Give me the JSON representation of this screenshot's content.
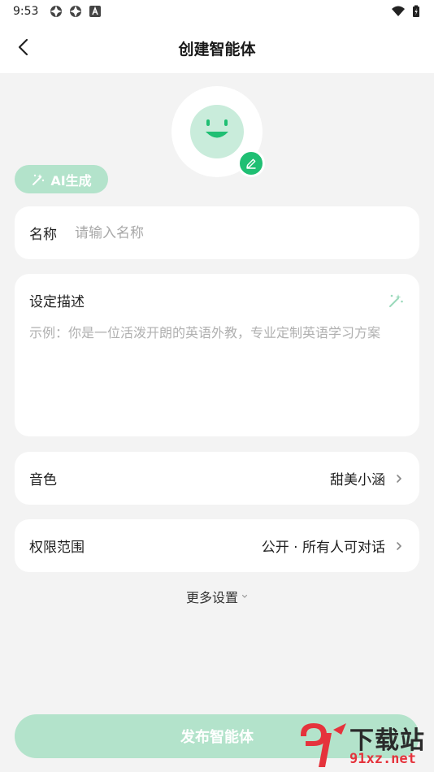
{
  "status_bar": {
    "time": "9:53"
  },
  "header": {
    "title": "创建智能体"
  },
  "avatar": {
    "ai_generate_label": "AI生成"
  },
  "name_field": {
    "label": "名称",
    "placeholder": "请输入名称",
    "value": ""
  },
  "description": {
    "label": "设定描述",
    "placeholder": "示例：你是一位活泼开朗的英语外教，专业定制英语学习方案",
    "value": ""
  },
  "voice": {
    "label": "音色",
    "value": "甜美小涵"
  },
  "permission": {
    "label": "权限范围",
    "value": "公开 · 所有人可对话"
  },
  "more_settings_label": "更多设置",
  "publish_label": "发布智能体",
  "watermark": {
    "text": "下载站",
    "url": "91xz.net"
  },
  "colors": {
    "accent": "#1fbf73",
    "accent_light": "#b3e3cb",
    "avatar_bg": "#c9ecdb",
    "page_bg": "#f3f3f3",
    "card_bg": "#ffffff"
  },
  "icons": {
    "back": "chevron-left-icon",
    "edit": "pencil-icon",
    "ai": "magic-wand-icon",
    "row": "chevron-right-icon",
    "dropdown": "chevron-down-icon"
  }
}
